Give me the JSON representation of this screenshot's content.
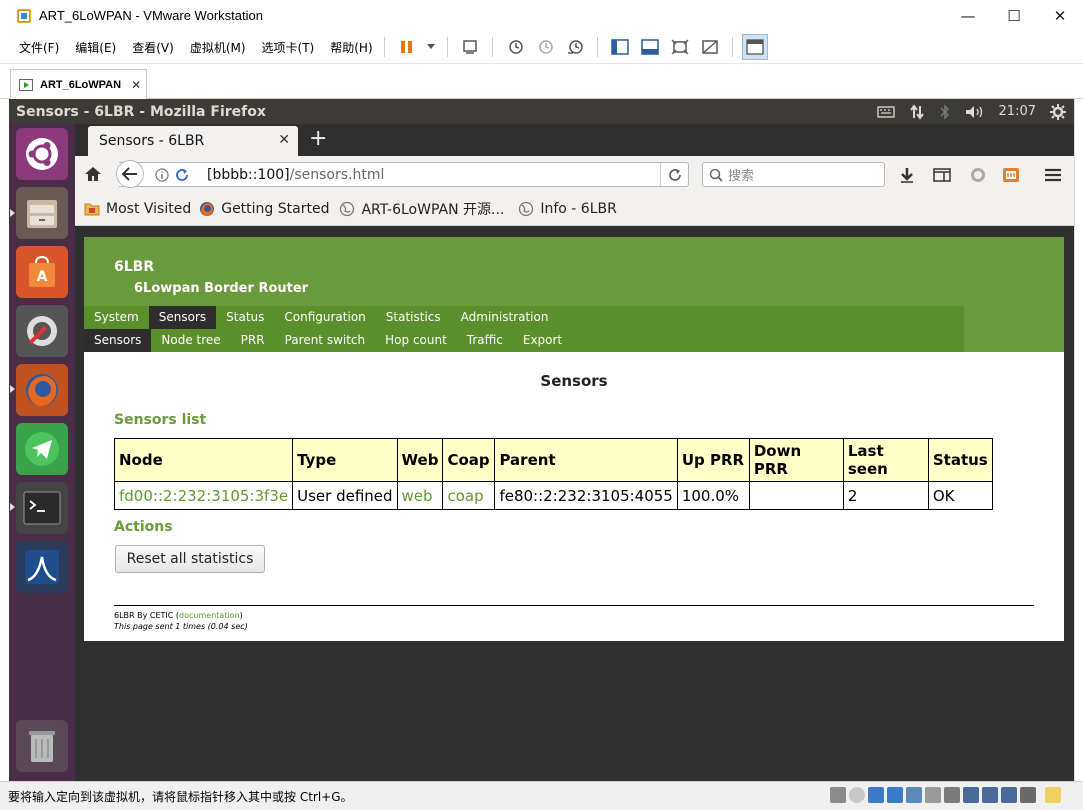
{
  "vmware": {
    "window_title": "ART_6LoWPAN - VMware Workstation",
    "controls": {
      "minimize": "—",
      "maximize": "☐",
      "close": "✕"
    },
    "menu": [
      "文件(F)",
      "编辑(E)",
      "查看(V)",
      "虚拟机(M)",
      "选项卡(T)",
      "帮助(H)"
    ],
    "tab_label": "ART_6LoWPAN",
    "status_text": "要将输入定向到该虚拟机，请将鼠标指针移入其中或按 Ctrl+G。"
  },
  "ubuntu": {
    "window_title": "Sensors - 6LBR - Mozilla Firefox",
    "clock": "21:07"
  },
  "firefox": {
    "tab_title": "Sensors - 6LBR",
    "url_host": "[bbbb::100]",
    "url_path": "/sensors.html",
    "search_placeholder": "搜索",
    "bookmarks": [
      "Most Visited",
      "Getting Started",
      "ART-6LoWPAN 开源...",
      "Info - 6LBR"
    ]
  },
  "page": {
    "brand": "6LBR",
    "subtitle": "6Lowpan Border Router",
    "menu": [
      "System",
      "Sensors",
      "Status",
      "Configuration",
      "Statistics",
      "Administration"
    ],
    "submenu": [
      "Sensors",
      "Node tree",
      "PRR",
      "Parent switch",
      "Hop count",
      "Traffic",
      "Export"
    ],
    "title": "Sensors",
    "sensors_list_heading": "Sensors list",
    "table": {
      "headers": [
        "Node",
        "Type",
        "Web",
        "Coap",
        "Parent",
        "Up PRR",
        "Down PRR",
        "Last seen",
        "Status"
      ],
      "rows": [
        {
          "node": "fd00::2:232:3105:3f3e",
          "type": "User defined",
          "web": "web",
          "coap": "coap",
          "parent": "fe80::2:232:3105:4055",
          "up_prr": "100.0%",
          "down_prr": "",
          "last_seen": "2",
          "status": "OK"
        }
      ]
    },
    "actions_heading": "Actions",
    "reset_button": "Reset all statistics",
    "footer_by": "6LBR By CETIC (",
    "footer_link": "documentation",
    "footer_close": ")",
    "footer_sent": "This page sent 1 times (0.04 sec)"
  }
}
